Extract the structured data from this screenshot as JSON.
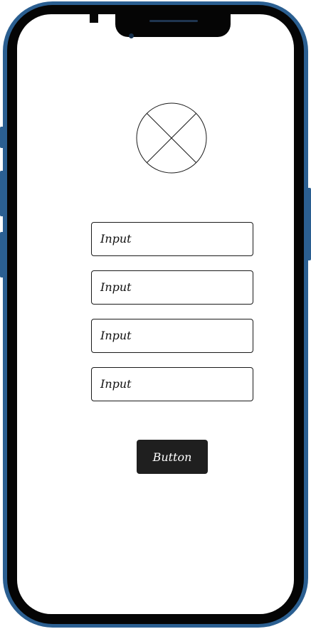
{
  "frame": {
    "color": "#2b5f91",
    "bezel_color": "#050505"
  },
  "image_placeholder": {
    "icon": "image-placeholder-icon"
  },
  "inputs": [
    {
      "value": "Input"
    },
    {
      "value": "Input"
    },
    {
      "value": "Input"
    },
    {
      "value": "Input"
    }
  ],
  "button": {
    "label": "Button"
  }
}
